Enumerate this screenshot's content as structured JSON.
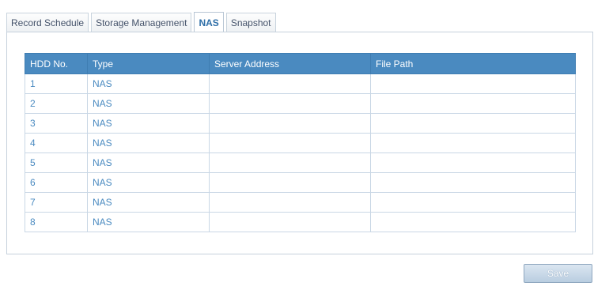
{
  "tabs": [
    {
      "label": "Record Schedule",
      "active": false
    },
    {
      "label": "Storage Management",
      "active": false
    },
    {
      "label": "NAS",
      "active": true
    },
    {
      "label": "Snapshot",
      "active": false
    }
  ],
  "table": {
    "headers": [
      "HDD No.",
      "Type",
      "Server Address",
      "File Path"
    ],
    "rows": [
      {
        "hdd": "1",
        "type": "NAS",
        "server": "",
        "path": ""
      },
      {
        "hdd": "2",
        "type": "NAS",
        "server": "",
        "path": ""
      },
      {
        "hdd": "3",
        "type": "NAS",
        "server": "",
        "path": ""
      },
      {
        "hdd": "4",
        "type": "NAS",
        "server": "",
        "path": ""
      },
      {
        "hdd": "5",
        "type": "NAS",
        "server": "",
        "path": ""
      },
      {
        "hdd": "6",
        "type": "NAS",
        "server": "",
        "path": ""
      },
      {
        "hdd": "7",
        "type": "NAS",
        "server": "",
        "path": ""
      },
      {
        "hdd": "8",
        "type": "NAS",
        "server": "",
        "path": ""
      }
    ]
  },
  "save_label": "Save",
  "colors": {
    "header_bg": "#4a8ac0",
    "cell_text": "#4a8ac0",
    "active_tab_text": "#2f6fa8"
  }
}
